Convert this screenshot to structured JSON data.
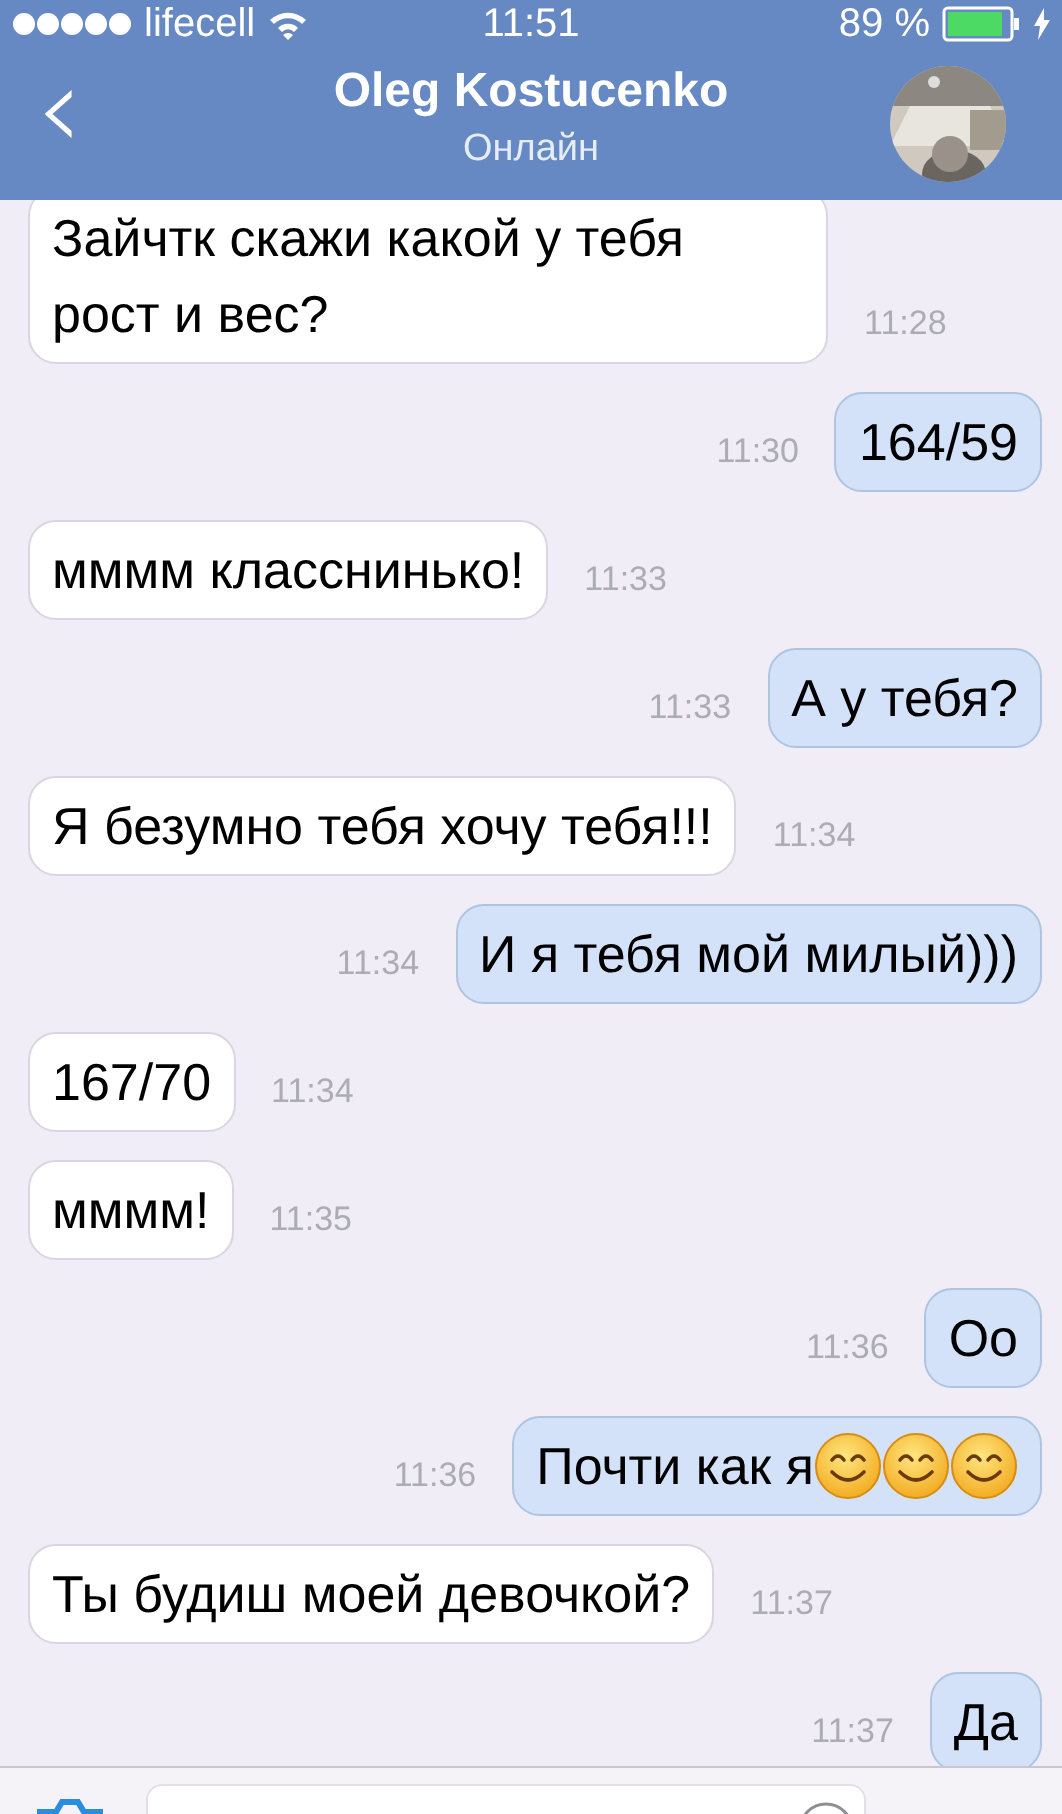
{
  "status_bar": {
    "carrier": "lifecell",
    "time": "11:51",
    "battery_text": "89 %"
  },
  "header": {
    "back": "‹",
    "name": "Oleg Kostucenko",
    "presence": "Онлайн"
  },
  "messages": [
    {
      "outgoing": false,
      "text": "Зайчтк скажи какой у тебя рост и вес?",
      "time": "11:28"
    },
    {
      "outgoing": true,
      "text": "164/59",
      "time": "11:30"
    },
    {
      "outgoing": false,
      "text": "мммм класснинько!",
      "time": "11:33"
    },
    {
      "outgoing": true,
      "text": "А у тебя?",
      "time": "11:33"
    },
    {
      "outgoing": false,
      "text": "Я безумно тебя хочу тебя!!!",
      "time": "11:34"
    },
    {
      "outgoing": true,
      "text": "И я тебя мой милый)))",
      "time": "11:34"
    },
    {
      "outgoing": false,
      "text": "167/70",
      "time": "11:34"
    },
    {
      "outgoing": false,
      "text": "мммм!",
      "time": "11:35"
    },
    {
      "outgoing": true,
      "text": "Оо",
      "time": "11:36"
    },
    {
      "outgoing": true,
      "text": "Почти как я",
      "time": "11:36",
      "attachments": [
        {
          "kind": "smiley"
        },
        {
          "kind": "smiley"
        },
        {
          "kind": "smiley"
        }
      ]
    },
    {
      "outgoing": false,
      "text": "Ты будиш моей девочкой?",
      "time": "11:37"
    },
    {
      "outgoing": true,
      "text": "Да",
      "time": "11:37"
    }
  ]
}
